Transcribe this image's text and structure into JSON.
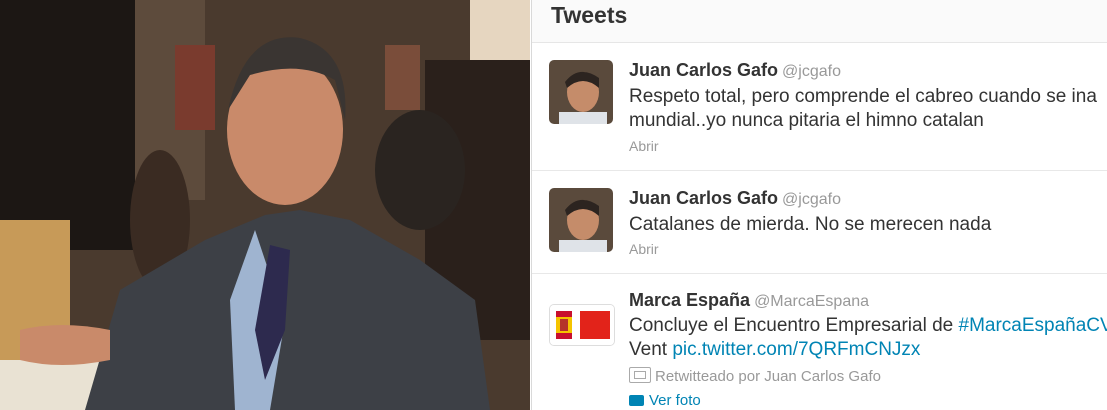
{
  "panel": {
    "title": "Tweets"
  },
  "tweets": [
    {
      "name": "Juan Carlos Gafo",
      "handle": "@jcgafo",
      "text": "Respeto total, pero comprende el cabreo cuando se ina\nmundial..yo nunca pitaria el himno catalan",
      "action": "Abrir"
    },
    {
      "name": "Juan Carlos Gafo",
      "handle": "@jcgafo",
      "text": "Catalanes de mierda. No se merecen nada",
      "action": "Abrir"
    },
    {
      "name": "Marca España",
      "handle": "@MarcaEspana",
      "text_line1_prefix": "Concluye el Encuentro Empresarial de ",
      "text_line1_hashtag": "#MarcaEspañaCV",
      "text_line2_prefix": "Vent ",
      "text_line2_link": "pic.twitter.com/7QRFmCNJzx",
      "retweet": "Retwitteado por Juan Carlos Gafo",
      "ver_foto": "Ver foto"
    }
  ],
  "colors": {
    "link": "#0084b4",
    "text": "#333333",
    "muted": "#999999"
  }
}
